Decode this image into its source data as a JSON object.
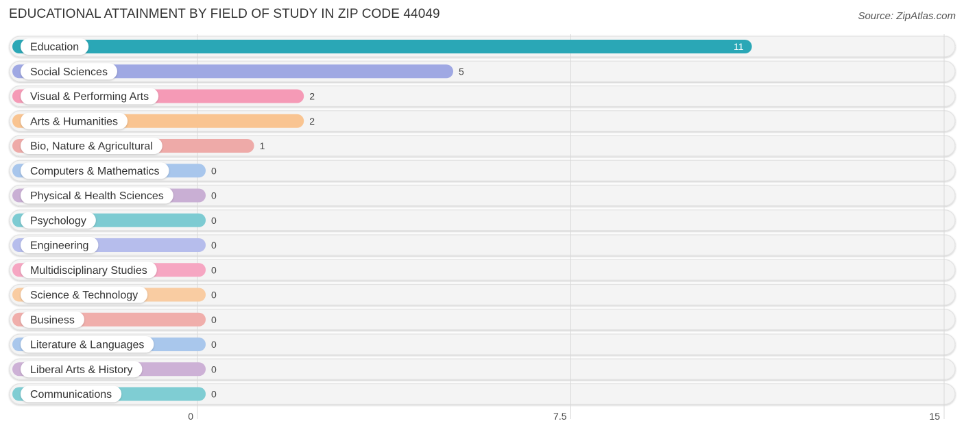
{
  "header": {
    "title": "EDUCATIONAL ATTAINMENT BY FIELD OF STUDY IN ZIP CODE 44049",
    "source": "Source: ZipAtlas.com"
  },
  "chart_data": {
    "type": "bar",
    "orientation": "horizontal",
    "title": "EDUCATIONAL ATTAINMENT BY FIELD OF STUDY IN ZIP CODE 44049",
    "xlabel": "",
    "ylabel": "",
    "xlim": [
      0,
      15
    ],
    "xticks": [
      0,
      7.5,
      15
    ],
    "xtick_labels": [
      "0",
      "7.5",
      "15"
    ],
    "grid": true,
    "categories": [
      "Education",
      "Social Sciences",
      "Visual & Performing Arts",
      "Arts & Humanities",
      "Bio, Nature & Agricultural",
      "Computers & Mathematics",
      "Physical & Health Sciences",
      "Psychology",
      "Engineering",
      "Multidisciplinary Studies",
      "Science & Technology",
      "Business",
      "Literature & Languages",
      "Liberal Arts & History",
      "Communications"
    ],
    "values": [
      11,
      5,
      2,
      2,
      1,
      0,
      0,
      0,
      0,
      0,
      0,
      0,
      0,
      0,
      0
    ],
    "value_labels": [
      "11",
      "5",
      "2",
      "2",
      "1",
      "0",
      "0",
      "0",
      "0",
      "0",
      "0",
      "0",
      "0",
      "0",
      "0"
    ],
    "colors": [
      "#2aa7b6",
      "#9fa8e3",
      "#f59ab6",
      "#f9c491",
      "#eeaaa8",
      "#a8c6ec",
      "#c9afd4",
      "#7dcbd2",
      "#b6bdec",
      "#f6a6c2",
      "#f9cca2",
      "#f0aeab",
      "#a9c7ec",
      "#cdb1d6",
      "#7fcdd3"
    ]
  }
}
